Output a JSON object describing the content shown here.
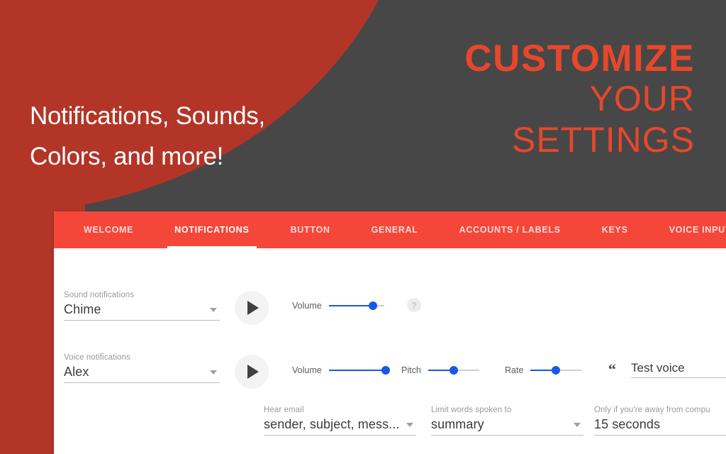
{
  "hero": {
    "tagline": "Notifications, Sounds,\nColors, and more!",
    "headline_line1": "CUSTOMIZE",
    "headline_line2": "YOUR",
    "headline_line3": "SETTINGS",
    "bg_dark": "#474747",
    "bg_red": "#B23527",
    "accent": "#E8472C"
  },
  "tabs": [
    {
      "label": "WELCOME",
      "active": false
    },
    {
      "label": "NOTIFICATIONS",
      "active": true
    },
    {
      "label": "BUTTON",
      "active": false
    },
    {
      "label": "GENERAL",
      "active": false
    },
    {
      "label": "ACCOUNTS / LABELS",
      "active": false
    },
    {
      "label": "KEYS",
      "active": false
    },
    {
      "label": "VOICE INPUT",
      "active": false
    }
  ],
  "tabbar_color": "#F4473A",
  "settings": {
    "sound_notifications": {
      "label": "Sound notifications",
      "value": "Chime",
      "play_icon": "play-icon",
      "volume": {
        "label": "Volume",
        "percent": 80
      },
      "help_icon": "?"
    },
    "voice_notifications": {
      "label": "Voice notifications",
      "value": "Alex",
      "play_icon": "play-icon",
      "volume": {
        "label": "Volume",
        "percent": 100
      },
      "pitch": {
        "label": "Pitch",
        "percent": 50
      },
      "rate": {
        "label": "Rate",
        "percent": 50
      },
      "quote_icon": "“",
      "test_voice": "Test voice"
    },
    "hear_email": {
      "label": "Hear email",
      "value": "sender, subject, mess..."
    },
    "limit_words": {
      "label": "Limit words spoken to",
      "value": "summary"
    },
    "away_delay": {
      "label": "Only if you're away from compu",
      "value": "15 seconds"
    }
  }
}
